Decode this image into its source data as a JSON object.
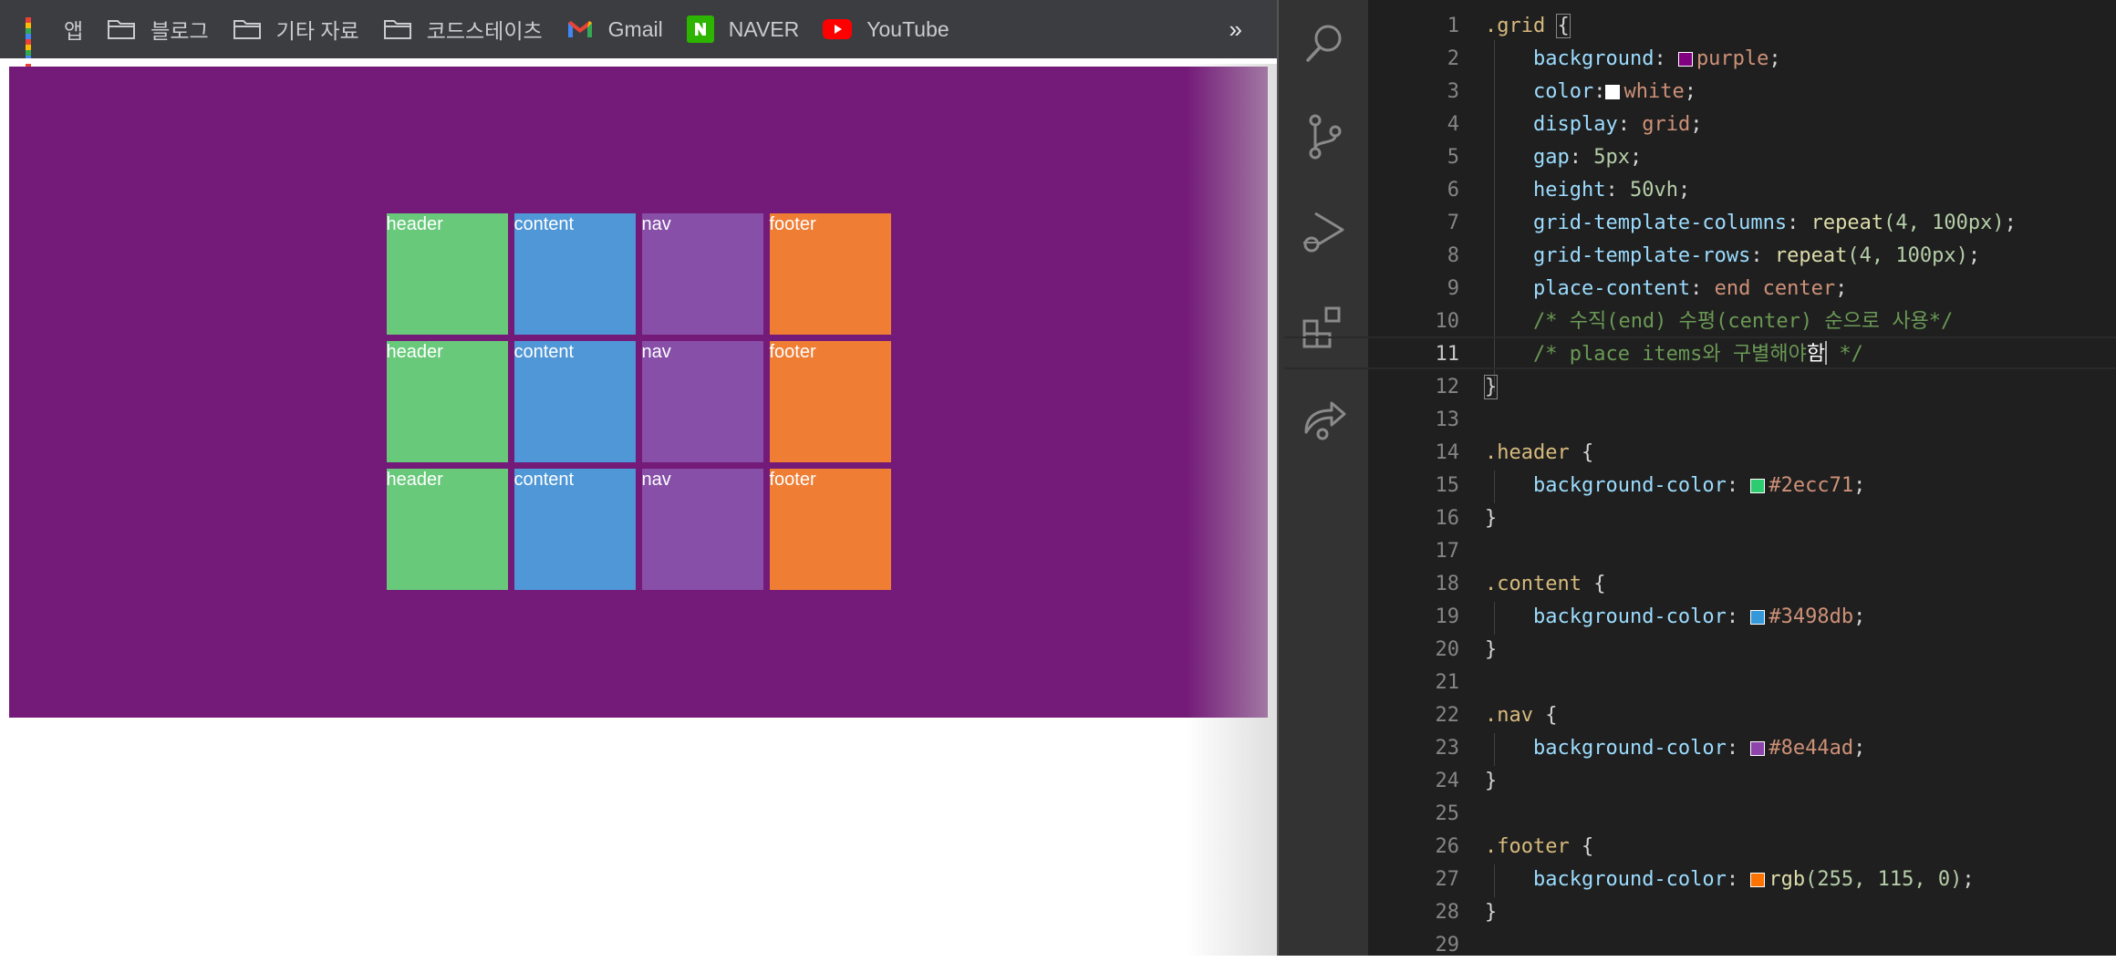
{
  "bookmarks": {
    "items": [
      {
        "label": "앱",
        "icon": "apps-grid-icon"
      },
      {
        "label": "블로그",
        "icon": "folder-icon"
      },
      {
        "label": "기타 자료",
        "icon": "folder-icon"
      },
      {
        "label": "코드스테이츠",
        "icon": "folder-icon"
      },
      {
        "label": "Gmail",
        "icon": "gmail-icon"
      },
      {
        "label": "NAVER",
        "icon": "naver-icon"
      },
      {
        "label": "YouTube",
        "icon": "youtube-icon"
      }
    ],
    "more": "»"
  },
  "grid_preview": {
    "background": "#741a78",
    "rows": [
      [
        "header",
        "content",
        "nav",
        "footer"
      ],
      [
        "header",
        "content",
        "nav",
        "footer"
      ],
      [
        "header",
        "content",
        "nav",
        "footer"
      ]
    ],
    "colors": {
      "header": "#68c97b",
      "content": "#4f97d6",
      "nav": "#874fa8",
      "footer": "#ef7d34"
    }
  },
  "editor": {
    "line_numbers": [
      "1",
      "2",
      "3",
      "4",
      "5",
      "6",
      "7",
      "8",
      "9",
      "10",
      "11",
      "12",
      "13",
      "14",
      "15",
      "16",
      "17",
      "18",
      "19",
      "20",
      "21",
      "22",
      "23",
      "24",
      "25",
      "26",
      "27",
      "28",
      "29"
    ],
    "current_line": "11",
    "lines": {
      "l1_sel": ".grid",
      "l1_brace": "{",
      "l2_prop": "background",
      "l2_val": "purple",
      "l3_prop": "color",
      "l3_val": "white",
      "l4_prop": "display",
      "l4_val": "grid",
      "l5_prop": "gap",
      "l5_num": "5px",
      "l6_prop": "height",
      "l6_num": "50vh",
      "l7_prop": "grid-template-columns",
      "l7_fn": "repeat",
      "l7_args": "(4, 100px)",
      "l8_prop": "grid-template-rows",
      "l8_fn": "repeat",
      "l8_args": "(4, 100px)",
      "l9_prop": "place-content",
      "l9_val": "end center",
      "l10_cmt": "/* 수직(end) 수평(center) 순으로 사용*/",
      "l11_cmt_a": "/* place items와 구별해야",
      "l11_cmt_b": "함",
      "l11_cmt_c": " */",
      "l12_brace": "}",
      "l14_sel": ".header",
      "l15_prop": "background-color",
      "l15_val": "#2ecc71",
      "l16": "}",
      "l18_sel": ".content",
      "l19_prop": "background-color",
      "l19_val": "#3498db",
      "l20": "}",
      "l22_sel": ".nav",
      "l23_prop": "background-color",
      "l23_val": "#8e44ad",
      "l24": "}",
      "l26_sel": ".footer",
      "l27_prop": "background-color",
      "l27_fn": "rgb",
      "l27_args": "(255, 115, 0)",
      "l28": "}"
    },
    "swatches": {
      "purple": "#800080",
      "white": "#ffffff",
      "green": "#2ecc71",
      "blue": "#3498db",
      "violet": "#8e44ad",
      "orange": "#ff7300"
    }
  }
}
